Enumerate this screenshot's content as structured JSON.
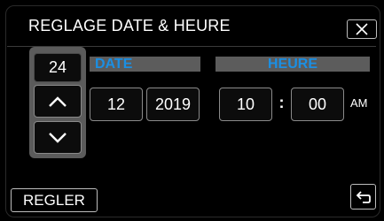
{
  "screen": {
    "title": "REGLAGE DATE & HEURE"
  },
  "date_section": {
    "header": "DATE",
    "day": "24",
    "month": "12",
    "year": "2019"
  },
  "time_section": {
    "header": "HEURE",
    "hour": "10",
    "separator": ":",
    "minute": "00",
    "period": "AM"
  },
  "buttons": {
    "apply_label": "REGLER",
    "up_icon": "chevron-up-icon",
    "down_icon": "chevron-down-icon",
    "close_icon": "close-icon",
    "back_icon": "back-return-icon"
  },
  "colors": {
    "accent": "#1b8fe3",
    "bar": "#5c5c5c",
    "background": "#000000"
  }
}
